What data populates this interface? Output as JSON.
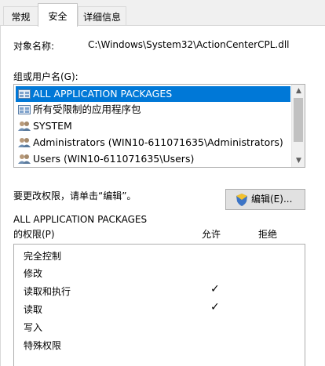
{
  "tabs": [
    "常规",
    "安全",
    "详细信息"
  ],
  "object": {
    "label": "对象名称:",
    "value": "C:\\Windows\\System32\\ActionCenterCPL.dll"
  },
  "groups": {
    "label": "组或用户名(G):",
    "items": [
      {
        "label": "ALL APPLICATION PACKAGES",
        "icon": "package-icon",
        "selected": true
      },
      {
        "label": "所有受限制的应用程序包",
        "icon": "package-icon",
        "selected": false
      },
      {
        "label": "SYSTEM",
        "icon": "users-icon",
        "selected": false
      },
      {
        "label": "Administrators (WIN10-611071635\\Administrators)",
        "icon": "users-icon",
        "selected": false
      },
      {
        "label": "Users (WIN10-611071635\\Users)",
        "icon": "users-icon",
        "selected": false
      }
    ]
  },
  "change_hint": "要更改权限，请单击“编辑”。",
  "edit_button": "编辑(E)...",
  "permissions": {
    "title": "ALL APPLICATION PACKAGES",
    "label": "的权限(P)",
    "allow_header": "允许",
    "deny_header": "拒绝",
    "rows": [
      {
        "name": "完全控制",
        "allow": false,
        "deny": false
      },
      {
        "name": "修改",
        "allow": false,
        "deny": false
      },
      {
        "name": "读取和执行",
        "allow": true,
        "deny": false
      },
      {
        "name": "读取",
        "allow": true,
        "deny": false
      },
      {
        "name": "写入",
        "allow": false,
        "deny": false
      },
      {
        "name": "特殊权限",
        "allow": false,
        "deny": false
      }
    ],
    "check_glyph": "✓"
  },
  "colors": {
    "selection": "#0078d7",
    "background": "#f0f0f0"
  }
}
